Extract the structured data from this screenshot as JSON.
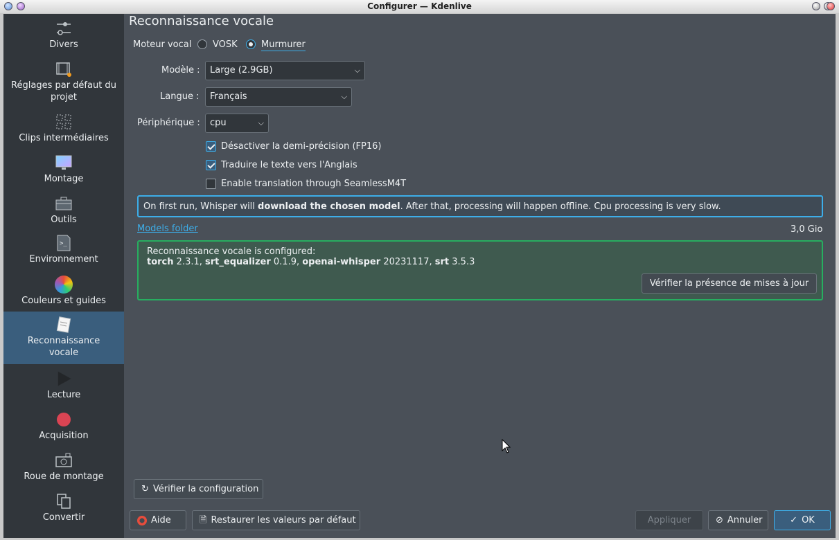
{
  "window": {
    "title": "Configurer — Kdenlive"
  },
  "sidebar": {
    "items": [
      {
        "label": "Divers",
        "icon": "sliders-icon"
      },
      {
        "label": "Réglages par défaut du projet",
        "icon": "film-settings-icon"
      },
      {
        "label": "Clips intermédiaires",
        "icon": "proxy-clips-icon"
      },
      {
        "label": "Montage",
        "icon": "monitor-icon"
      },
      {
        "label": "Outils",
        "icon": "toolbox-icon"
      },
      {
        "label": "Environnement",
        "icon": "terminal-icon"
      },
      {
        "label": "Couleurs et guides",
        "icon": "color-wheel-icon"
      },
      {
        "label": "Reconnaissance vocale",
        "icon": "notepad-icon",
        "active": true
      },
      {
        "label": "Lecture",
        "icon": "play-icon"
      },
      {
        "label": "Acquisition",
        "icon": "record-icon"
      },
      {
        "label": "Roue de montage",
        "icon": "jog-shuttle-icon"
      },
      {
        "label": "Convertir",
        "icon": "convert-copy-icon"
      }
    ]
  },
  "page": {
    "title": "Reconnaissance vocale",
    "engine_label": "Moteur vocal",
    "engine_options": [
      {
        "label": "VOSK",
        "selected": false
      },
      {
        "label": "Murmurer",
        "selected": true
      }
    ],
    "model_label": "Modèle :",
    "model_value": "Large (2.9GB)",
    "language_label": "Langue :",
    "language_value": "Français",
    "device_label": "Périphérique :",
    "device_value": "cpu",
    "checkboxes": [
      {
        "label": "Désactiver la demi-précision (FP16)",
        "checked": true
      },
      {
        "label": "Traduire le texte vers l'Anglais",
        "checked": true
      },
      {
        "label": "Enable translation through SeamlessM4T",
        "checked": false
      }
    ],
    "info": {
      "pre": "On first run, Whisper will ",
      "bold": "download the chosen model",
      "post": ". After that, processing will happen offline. Cpu processing is very slow."
    },
    "models_folder_link": "Models folder",
    "models_size": "3,0 Gio",
    "status": {
      "heading": "Reconnaissance vocale is configured:",
      "packages": [
        {
          "name": "torch",
          "version": "2.3.1"
        },
        {
          "name": "srt_equalizer",
          "version": "0.1.9"
        },
        {
          "name": "openai-whisper",
          "version": "20231117"
        },
        {
          "name": "srt",
          "version": "3.5.3"
        }
      ],
      "update_button": "Vérifier la présence de mises à jour"
    },
    "check_config_button": "Vérifier la configuration"
  },
  "footer": {
    "help": "Aide",
    "restore_defaults": "Restaurer les valeurs par défaut",
    "apply": "Appliquer",
    "cancel": "Annuler",
    "ok": "OK"
  },
  "colors": {
    "accent": "#3daee9",
    "success_border": "#27ae60",
    "sidebar_bg": "#31363b",
    "content_bg": "#4a5058",
    "selected_bg": "#3a5e7d"
  }
}
